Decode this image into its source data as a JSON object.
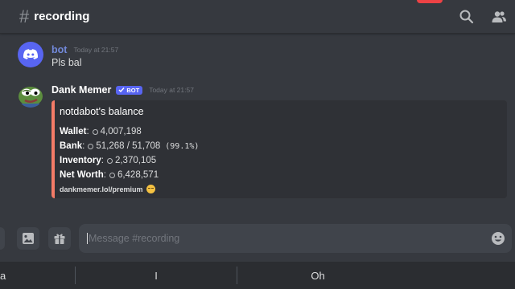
{
  "header": {
    "hash": "#",
    "channel": "recording"
  },
  "messages": [
    {
      "author": "bot",
      "timestamp": "Today at 21:57",
      "text": "Pls bal",
      "author_color": "#7289da"
    },
    {
      "author": "Dank Memer",
      "bot_tag": "BOT",
      "timestamp": "Today at 21:57",
      "author_color": "#ffffff",
      "embed": {
        "title": "notdabot's balance",
        "fields": [
          {
            "label": "Wallet",
            "value": "4,007,198"
          },
          {
            "label": "Bank",
            "value": "51,268 / 51,708",
            "extra": "(99.1%)"
          },
          {
            "label": "Inventory",
            "value": "2,370,105"
          },
          {
            "label": "Net Worth",
            "value": "6,428,571"
          }
        ],
        "footer": "dankmemer.lol/premium",
        "color": "#f47b67"
      }
    }
  ],
  "composer": {
    "placeholder": "Message #recording"
  },
  "suggestions": [
    "a",
    "I",
    "Oh"
  ],
  "icons": {
    "header": [
      "search-icon",
      "members-icon"
    ],
    "composer": [
      "image-icon",
      "gift-icon",
      "emoji-icon"
    ]
  }
}
